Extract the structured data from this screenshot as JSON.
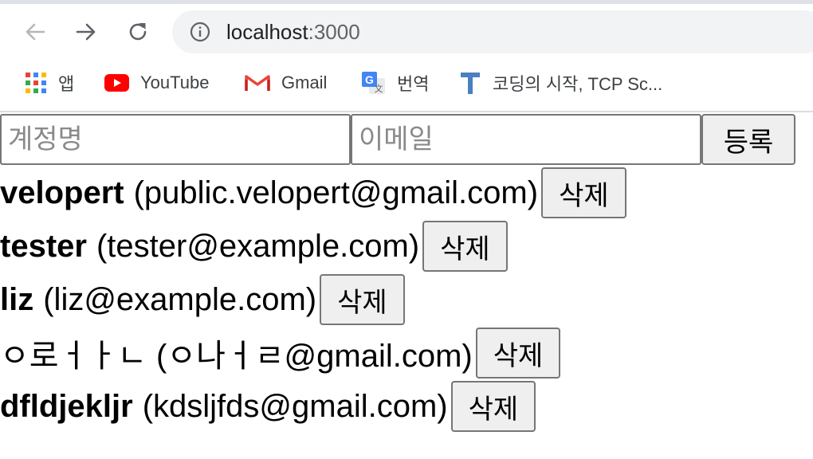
{
  "browser": {
    "url_host": "localhost",
    "url_port": ":3000"
  },
  "bookmarks": [
    {
      "label": "앱",
      "icon": "apps-grid-icon"
    },
    {
      "label": "YouTube",
      "icon": "youtube-icon"
    },
    {
      "label": "Gmail",
      "icon": "gmail-icon"
    },
    {
      "label": "번역",
      "icon": "google-translate-icon"
    },
    {
      "label": "코딩의 시작, TCP Sc...",
      "icon": "tcp-school-icon"
    }
  ],
  "form": {
    "username_placeholder": "계정명",
    "email_placeholder": "이메일",
    "submit_label": "등록"
  },
  "users": [
    {
      "username": "velopert",
      "email": "(public.velopert@gmail.com)",
      "delete_label": "삭제"
    },
    {
      "username": "tester",
      "email": "(tester@example.com)",
      "delete_label": "삭제"
    },
    {
      "username": "liz",
      "email": "(liz@example.com)",
      "delete_label": "삭제"
    },
    {
      "username": "ㅇ로ㅓㅏㄴ",
      "email": "(ㅇ나ㅓㄹ@gmail.com)",
      "delete_label": "삭제"
    },
    {
      "username": "dfldjekljr",
      "email": "(kdsljfds@gmail.com)",
      "delete_label": "삭제"
    }
  ]
}
